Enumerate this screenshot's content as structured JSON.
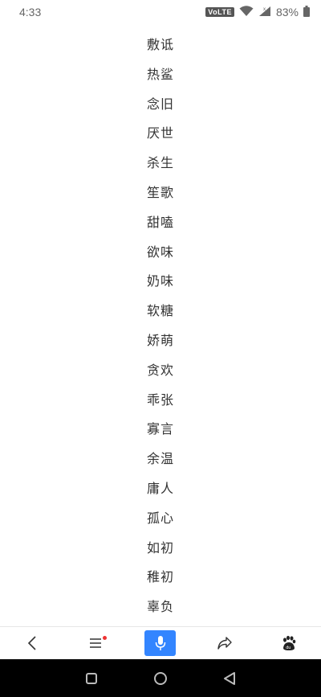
{
  "status_bar": {
    "time": "4:33",
    "volte": "VoLTE",
    "battery": "83%"
  },
  "words": [
    "敷诋",
    "热鲨",
    "念旧",
    "厌世",
    "杀生",
    "笙歌",
    "甜嗑",
    "欲味",
    "奶味",
    "软糖",
    "娇萌",
    "贪欢",
    "乖张",
    "寡言",
    "余温",
    "庸人",
    "孤心",
    "如初",
    "稚初",
    "辜负"
  ],
  "toolbar": {
    "back_icon": "chevron-left-icon",
    "menu_icon": "menu-icon",
    "mic_icon": "microphone-icon",
    "share_icon": "share-icon",
    "baidu_icon": "baidu-paw-icon",
    "accent": "#3385ff",
    "badge_color": "#ee3333"
  },
  "nav_bar": {
    "recent_icon": "square-icon",
    "home_icon": "circle-icon",
    "back_icon": "triangle-back-icon"
  }
}
